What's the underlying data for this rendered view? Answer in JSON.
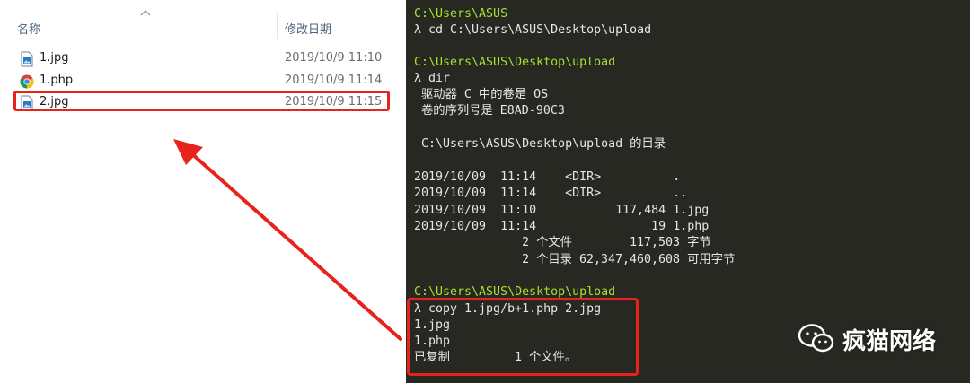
{
  "explorer": {
    "columns": {
      "name": "名称",
      "date_modified": "修改日期"
    },
    "files": [
      {
        "name": "1.jpg",
        "date": "2019/10/9 11:10",
        "icon": "jpg-file-icon"
      },
      {
        "name": "1.php",
        "date": "2019/10/9 11:14",
        "icon": "chrome-icon"
      },
      {
        "name": "2.jpg",
        "date": "2019/10/9 11:15",
        "icon": "jpg-file-icon"
      }
    ]
  },
  "terminal": {
    "lines": [
      "C:\\Users\\ASUS",
      "λ cd C:\\Users\\ASUS\\Desktop\\upload",
      "",
      "C:\\Users\\ASUS\\Desktop\\upload",
      "λ dir",
      " 驱动器 C 中的卷是 OS",
      " 卷的序列号是 E8AD-90C3",
      "",
      " C:\\Users\\ASUS\\Desktop\\upload 的目录",
      "",
      "2019/10/09  11:14    <DIR>          .",
      "2019/10/09  11:14    <DIR>          ..",
      "2019/10/09  11:10           117,484 1.jpg",
      "2019/10/09  11:14                19 1.php",
      "               2 个文件        117,503 字节",
      "               2 个目录 62,347,460,608 可用字节",
      "",
      "C:\\Users\\ASUS\\Desktop\\upload",
      "λ copy 1.jpg/b+1.php 2.jpg",
      "1.jpg",
      "1.php",
      "已复制         1 个文件。"
    ],
    "prompt_color": "#a6e22e",
    "text_color": "#e6e6e6",
    "background": "#272822"
  },
  "annotation": {
    "highlight_color": "#e8231b"
  },
  "watermark": {
    "text": "疯猫网络",
    "icon": "wechat-icon"
  }
}
